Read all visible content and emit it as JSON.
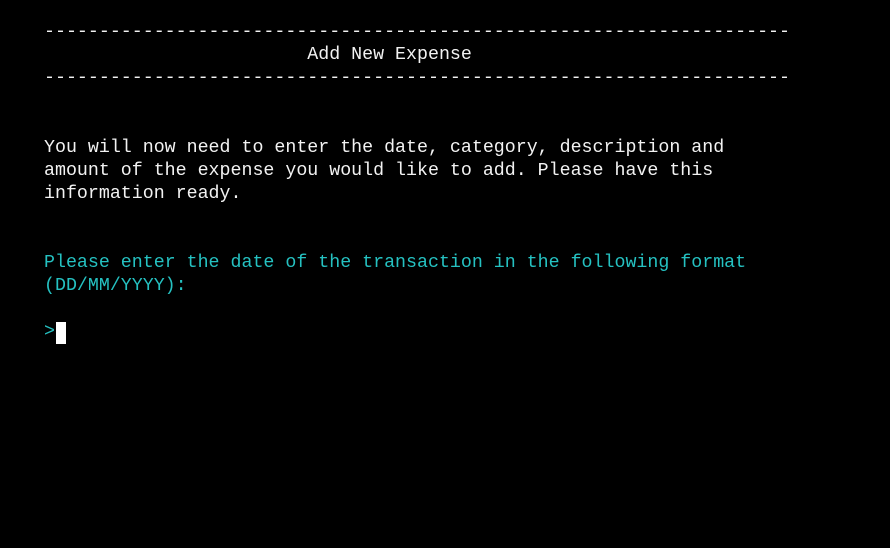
{
  "header": {
    "rule_top": "--------------------------------------------------------------------",
    "title": "                        Add New Expense",
    "rule_bottom": "--------------------------------------------------------------------"
  },
  "intro": {
    "line1": "You will now need to enter the date, category, description and",
    "line2": "amount of the expense you would like to add. Please have this",
    "line3": "information ready."
  },
  "prompt": {
    "line1": "Please enter the date of the transaction in the following format",
    "line2": "(DD/MM/YYYY):",
    "symbol": ">",
    "input_value": ""
  },
  "colors": {
    "background": "#000000",
    "text": "#f2f2f2",
    "prompt": "#25c1c1",
    "cursor": "#ffffff"
  }
}
